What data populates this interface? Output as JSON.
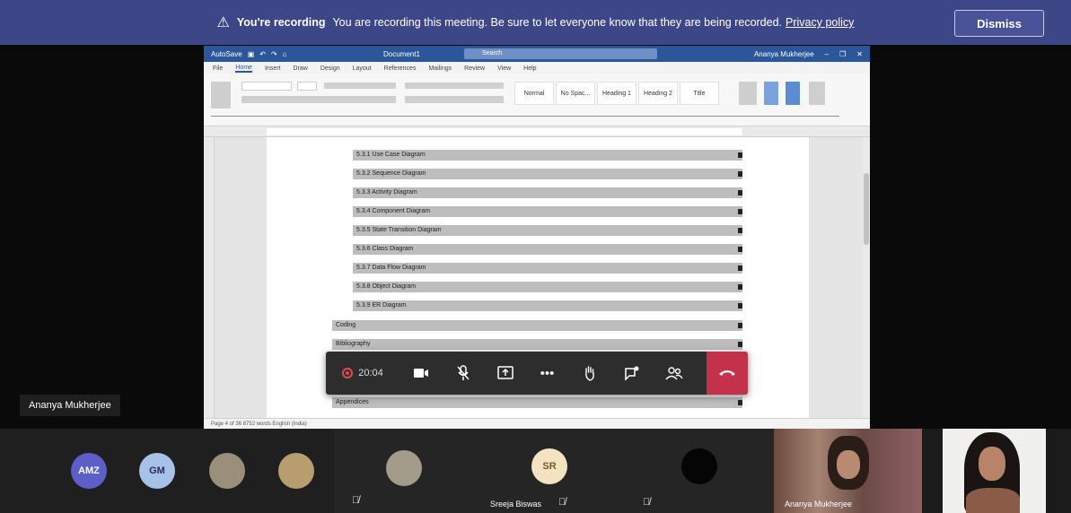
{
  "banner": {
    "icon": "warning-icon",
    "message": "You're recording",
    "detail": "You are recording this meeting. Be sure to let everyone know that they are being recorded.",
    "link": "Privacy policy",
    "dismiss_label": "Dismiss"
  },
  "presenter": {
    "name": "Ananya Mukherjee"
  },
  "word": {
    "title_left": "AutoSave",
    "doc_name": "Document1",
    "search_placeholder": "Search",
    "user": "Ananya Mukherjee",
    "tabs": [
      "File",
      "Home",
      "Insert",
      "Draw",
      "Design",
      "Layout",
      "References",
      "Mailings",
      "Review",
      "View",
      "Help"
    ],
    "active_tab": "Home",
    "styles": [
      "Normal",
      "No Spac...",
      "Heading 1",
      "Heading 2",
      "Title"
    ],
    "toc": [
      "5.3.1 Use Case Diagram",
      "5.3.2 Sequence Diagram",
      "5.3.3 Activity Diagram",
      "5.3.4 Component Diagram",
      "5.3.5 State Transition Diagram",
      "5.3.6 Class Diagram",
      "5.3.7 Data Flow Diagram",
      "5.3.8 Object Diagram",
      "5.3.9 ER Diagram",
      "Coding",
      "Bibliography"
    ],
    "toc_last": "Appendices",
    "status": "Page 4 of 36   8752 words   English (India)"
  },
  "controls": {
    "timer": "20:04",
    "items": [
      "camera-icon",
      "mic-off-icon",
      "share-icon",
      "more-icon",
      "raise-hand-icon",
      "chat-icon",
      "participants-icon"
    ]
  },
  "participants": [
    {
      "initials": "AMZ",
      "color": "#5b5fc7"
    },
    {
      "initials": "GM",
      "color": "#a8c1e8"
    },
    {
      "initials": "",
      "color": "#9a8f7a"
    },
    {
      "initials": "",
      "color": "#b89d6e"
    }
  ],
  "tiles": [
    {
      "initials": "",
      "color": "#a39c8a"
    },
    {
      "initials": "SR",
      "color": "#f4e3c0",
      "name": "Sreeja Biswas"
    },
    {
      "initials": "",
      "color": "#050505"
    },
    {
      "name": "Ananya Mukherjee"
    }
  ]
}
